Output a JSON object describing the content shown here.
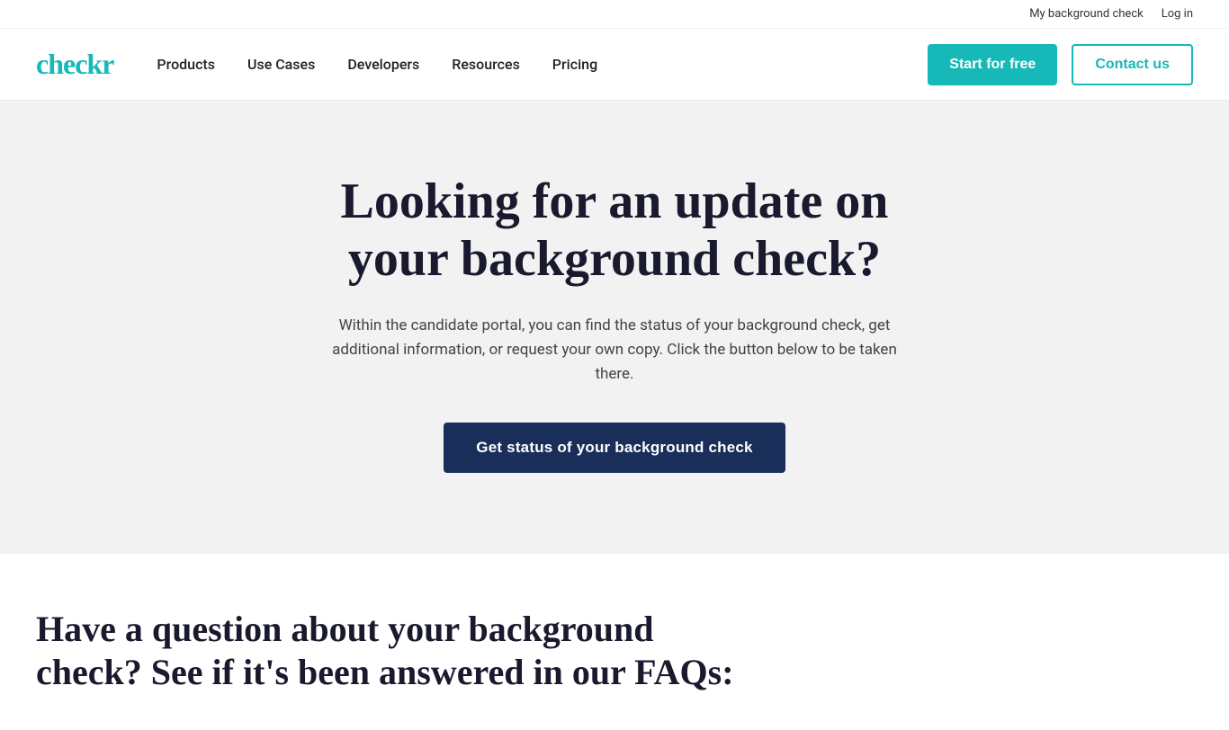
{
  "topbar": {
    "my_background_check": "My background check",
    "login": "Log in"
  },
  "navbar": {
    "logo": "checkr",
    "nav_items": [
      {
        "label": "Products",
        "id": "products"
      },
      {
        "label": "Use Cases",
        "id": "use-cases"
      },
      {
        "label": "Developers",
        "id": "developers"
      },
      {
        "label": "Resources",
        "id": "resources"
      },
      {
        "label": "Pricing",
        "id": "pricing"
      }
    ],
    "start_btn": "Start for free",
    "contact_btn": "Contact us"
  },
  "hero": {
    "title": "Looking for an update on your background check?",
    "subtitle": "Within the candidate portal, you can find the status of your background check, get additional information, or request your own copy. Click the button below to be taken there.",
    "cta_btn": "Get status of your background check"
  },
  "faq": {
    "title": "Have a question about your background check? See if it's been answered in our FAQs:"
  },
  "colors": {
    "teal": "#17b8b8",
    "dark_navy": "#1a2e5a",
    "dark_text": "#1a1a2e",
    "bg_gray": "#f2f2f2"
  }
}
